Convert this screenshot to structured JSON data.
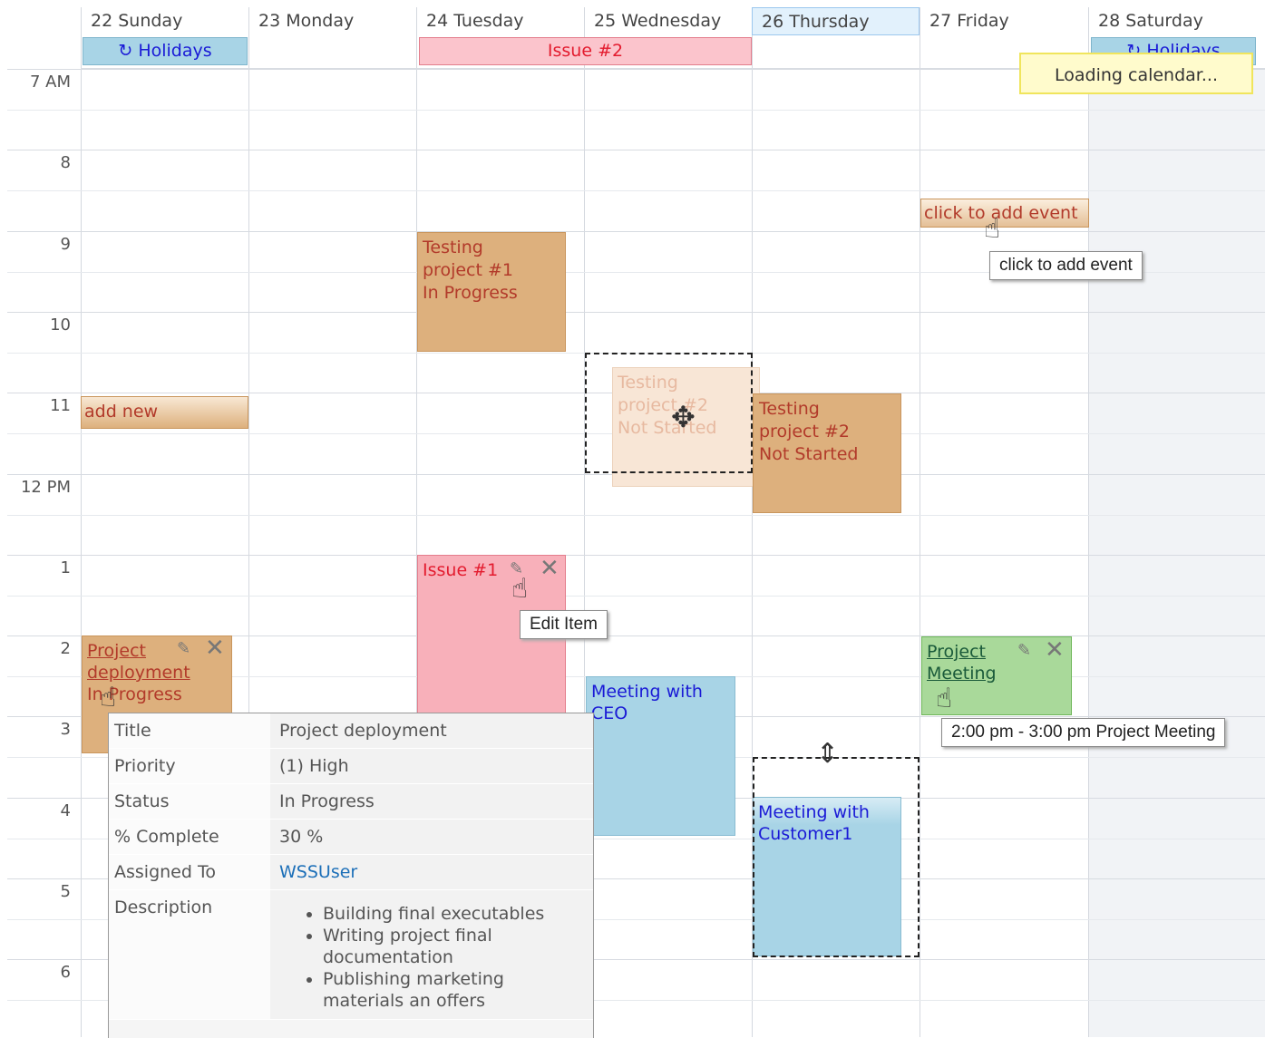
{
  "days": [
    {
      "label": "22 Sunday"
    },
    {
      "label": "23 Monday"
    },
    {
      "label": "24 Tuesday"
    },
    {
      "label": "25 Wednesday"
    },
    {
      "label": "26 Thursday"
    },
    {
      "label": "27 Friday"
    },
    {
      "label": "28 Saturday"
    }
  ],
  "hours": [
    "7 AM",
    "8",
    "9",
    "10",
    "11",
    "12 PM",
    "1",
    "2",
    "3",
    "4",
    "5",
    "6"
  ],
  "allday": {
    "holiday1": "↻ Holidays",
    "issue2": "Issue #2",
    "holiday2": "↻ Holidays",
    "loading": "Loading calendar..."
  },
  "events": {
    "testing1": [
      "Testing",
      "project #1",
      "In Progress"
    ],
    "add_new": "add new",
    "ghost": [
      "Testing",
      "project #2",
      "Not Started"
    ],
    "testing2": [
      "Testing",
      "project #2",
      "Not Started"
    ],
    "click_add": "click to add event",
    "click_add_tip": "click to add event",
    "issue1": "Issue #1",
    "edit_tip": "Edit Item",
    "proj_deploy": [
      "Project",
      "deployment",
      "In Progress"
    ],
    "meeting_ceo": [
      "Meeting with",
      "CEO"
    ],
    "meeting_cust": [
      "Meeting with",
      "Customer1"
    ],
    "proj_meeting": [
      "Project",
      "Meeting"
    ],
    "proj_meeting_tip": "2:00 pm - 3:00 pm Project Meeting"
  },
  "detail": {
    "rows": [
      {
        "label": "Title",
        "value": "Project deployment"
      },
      {
        "label": "Priority",
        "value": "(1) High"
      },
      {
        "label": "Status",
        "value": "In Progress"
      },
      {
        "label": "% Complete",
        "value": "30 %"
      },
      {
        "label": "Assigned To",
        "value": "WSSUser"
      }
    ],
    "desc_label": "Description",
    "desc_items": [
      "Building final executables",
      "Writing project final documentation",
      "Publishing marketing materials an offers"
    ]
  },
  "colors": {
    "event_tan": "#ddb07d",
    "event_pink": "#f8b0ba",
    "event_blue": "#a8d4e6",
    "event_green": "#a9d99a",
    "today": "#e2f1fc"
  }
}
